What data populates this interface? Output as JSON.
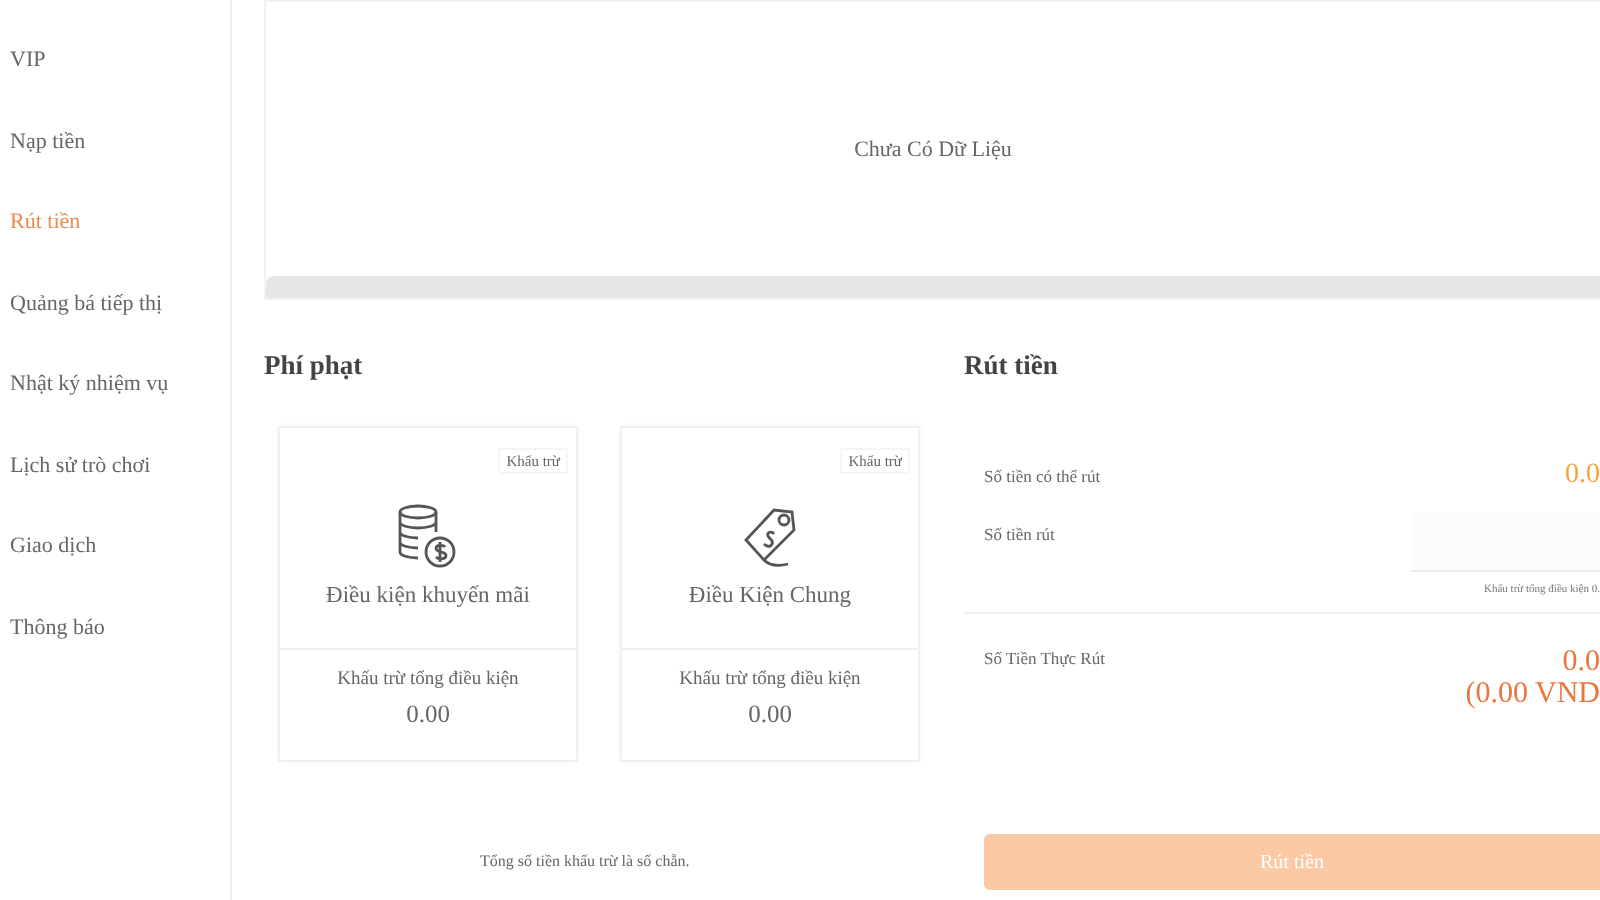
{
  "sidebar": {
    "items": [
      {
        "label": "VIP",
        "selected": false
      },
      {
        "label": "Nạp tiền",
        "selected": false
      },
      {
        "label": "Rút tiền",
        "selected": true
      },
      {
        "label": "Quảng bá tiếp thị",
        "selected": false
      },
      {
        "label": "Nhật ký nhiệm vụ",
        "selected": false
      },
      {
        "label": "Lịch sử trò chơi",
        "selected": false
      },
      {
        "label": "Giao dịch",
        "selected": false
      },
      {
        "label": "Thông báo",
        "selected": false
      }
    ]
  },
  "records": {
    "empty_text": "Chưa Có Dữ Liệu"
  },
  "penalty": {
    "title": "Phí phạt",
    "cards": [
      {
        "kind": "coins",
        "badge": "Khấu trừ",
        "title": "Điều kiện khuyến mãi",
        "label": "Khấu trừ tổng điều kiện",
        "value": "0.00"
      },
      {
        "kind": "tag",
        "badge": "Khấu trừ",
        "title": "Điều Kiện Chung",
        "label": "Khấu trừ tổng điều kiện",
        "value": "0.00"
      }
    ],
    "note": "Tổng số tiền khấu trừ là số chẵn."
  },
  "withdraw": {
    "title": "Rút tiền",
    "available_label": "Số tiền có thể rút",
    "available_value": "0.0",
    "amount_label": "Số tiền rút",
    "amount_hint": "Khấu trừ tổng điều kiện 0.",
    "actual_label": "Số Tiền Thực Rút",
    "actual_value": "0.0",
    "actual_vnd": "(0.00 VND",
    "button": "Rút tiền"
  }
}
